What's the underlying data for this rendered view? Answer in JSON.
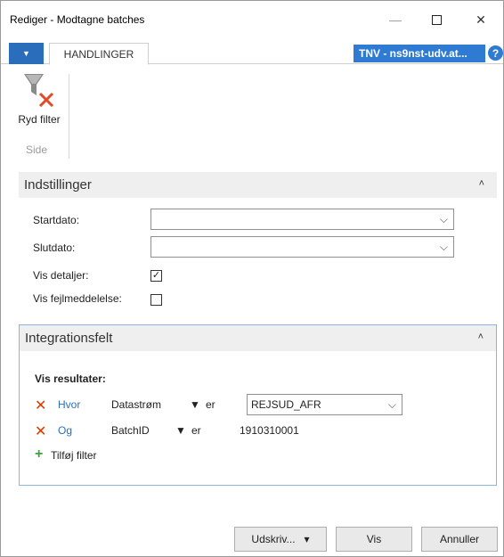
{
  "window": {
    "title": "Rediger - Modtagne batches",
    "minimize_glyph": "—",
    "close_glyph": "✕"
  },
  "ribbon": {
    "app_menu_glyph": "▼",
    "tab_label": "HANDLINGER",
    "server_badge": "TNV - ns9nst-udv.at...",
    "help_glyph": "?",
    "clear_filter_label": "Ryd filter",
    "group_label": "Side"
  },
  "settings": {
    "header": "Indstillinger",
    "collapse_glyph": "˄",
    "start_date_label": "Startdato:",
    "start_date_value": "",
    "end_date_label": "Slutdato:",
    "end_date_value": "",
    "show_details_label": "Vis detaljer:",
    "show_details_checked": true,
    "show_errors_label": "Vis fejlmeddelelse:",
    "show_errors_checked": false,
    "dropdown_glyph": "⌵"
  },
  "integration": {
    "header": "Integrationsfelt",
    "collapse_glyph": "˄",
    "results_label": "Vis resultater:",
    "remove_glyph": "✕",
    "filters": [
      {
        "connector": "Hvor",
        "field": "Datastrøm",
        "operator": "er",
        "value": "REJSUD_AFR"
      },
      {
        "connector": "Og",
        "field": "BatchID",
        "operator": "er",
        "value": "1910310001"
      }
    ],
    "add_filter_glyph": "+",
    "add_filter_label": "Tilføj filter"
  },
  "footer": {
    "print_label": "Udskriv...",
    "print_caret": "▾",
    "view_label": "Vis",
    "cancel_label": "Annuller"
  },
  "colors": {
    "accent": "#2a6ebb",
    "badge": "#2f7bd3",
    "remove": "#d83b01",
    "add": "#3aa53a"
  }
}
